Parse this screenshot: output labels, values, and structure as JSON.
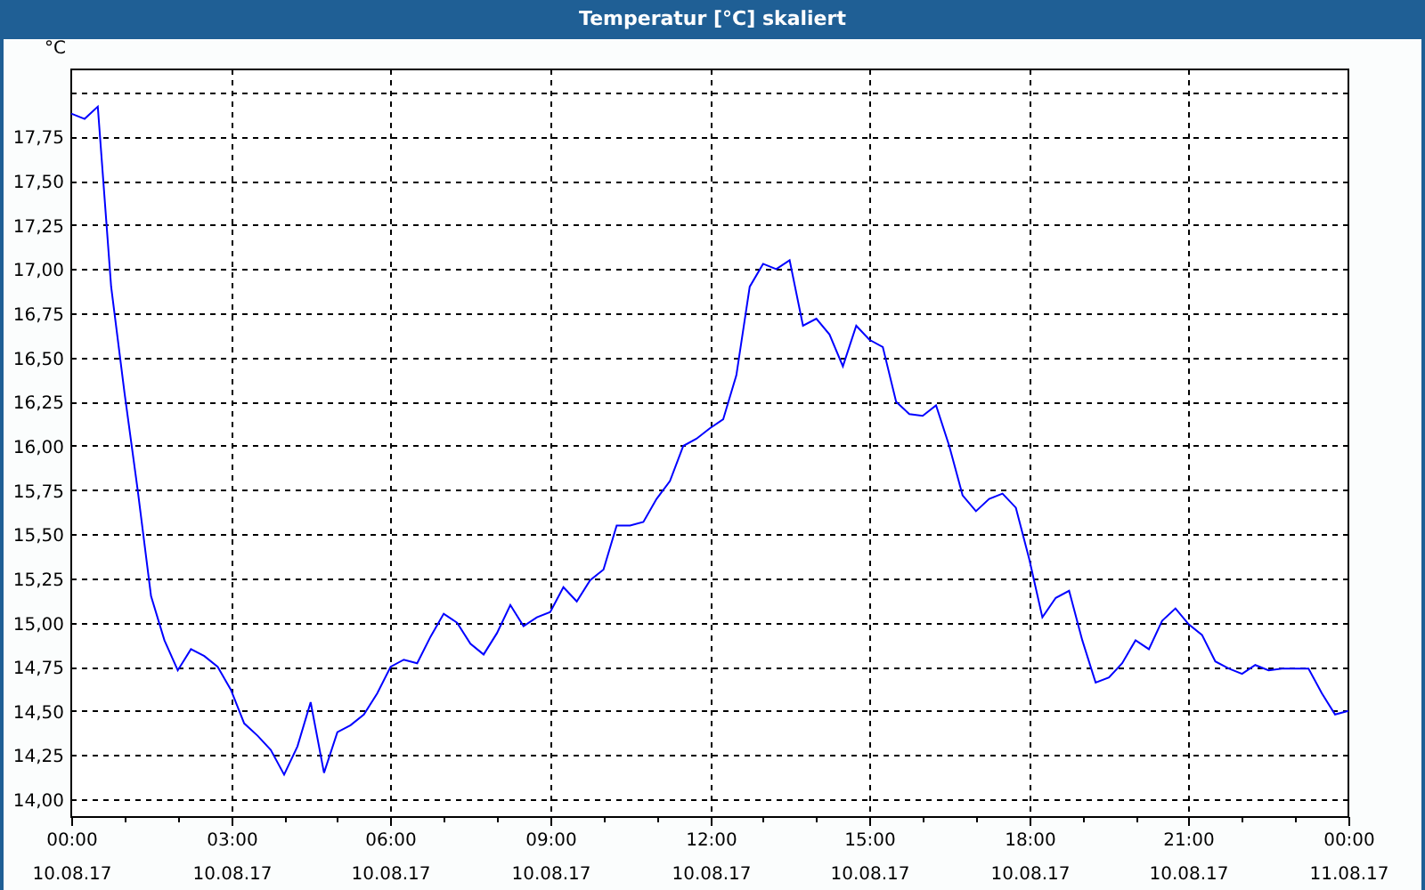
{
  "window": {
    "title": "Temperatur [°C] skaliert"
  },
  "chart": {
    "chart_data": {
      "type": "line",
      "grid": true,
      "ylabel": "°C",
      "ylim": [
        13.9,
        18.13
      ],
      "categories": [
        "00:00\n10.08.17",
        null,
        null,
        null,
        null,
        null,
        null,
        null,
        null,
        null,
        null,
        null,
        "03:00\n10.08.17",
        null,
        null,
        null,
        null,
        null,
        null,
        null,
        null,
        null,
        null,
        null,
        "06:00\n10.08.17",
        null,
        null,
        null,
        null,
        null,
        null,
        null,
        null,
        null,
        null,
        null,
        "09:00\n10.08.17",
        null,
        null,
        null,
        null,
        null,
        null,
        null,
        null,
        null,
        null,
        null,
        "12:00\n10.08.17",
        null,
        null,
        null,
        null,
        null,
        null,
        null,
        null,
        null,
        null,
        null,
        "15:00\n10.08.17",
        null,
        null,
        null,
        null,
        null,
        null,
        null,
        null,
        null,
        null,
        null,
        "18:00\n10.08.17",
        null,
        null,
        null,
        null,
        null,
        null,
        null,
        null,
        null,
        null,
        null,
        "21:00\n10.08.17",
        null,
        null,
        null,
        null,
        null,
        null,
        null,
        null,
        null,
        null,
        null,
        "00:00\n11.08.17"
      ],
      "yticks": [
        {
          "value": 14,
          "label": "14,00"
        },
        {
          "value": 14.25,
          "label": "14,25"
        },
        {
          "value": 14.5,
          "label": "14,50"
        },
        {
          "value": 14.75,
          "label": "14,75"
        },
        {
          "value": 15,
          "label": "15,00"
        },
        {
          "value": 15.25,
          "label": "15,25"
        },
        {
          "value": 15.5,
          "label": "15,50"
        },
        {
          "value": 15.75,
          "label": "15,75"
        },
        {
          "value": 16,
          "label": "16,00"
        },
        {
          "value": 16.25,
          "label": "16,25"
        },
        {
          "value": 16.5,
          "label": "16,50"
        },
        {
          "value": 16.75,
          "label": "16,75"
        },
        {
          "value": 17,
          "label": "17,00"
        },
        {
          "value": 17.25,
          "label": "17,25"
        },
        {
          "value": 17.5,
          "label": "17,50"
        },
        {
          "value": 17.75,
          "label": "17,75"
        }
      ],
      "series": [
        {
          "color": "#0000ff",
          "values": [
            17.88,
            17.85,
            17.92,
            16.9,
            16.3,
            15.75,
            15.15,
            14.9,
            14.73,
            14.85,
            14.81,
            14.75,
            14.62,
            14.43,
            14.36,
            14.28,
            14.14,
            14.3,
            14.55,
            14.15,
            14.38,
            14.42,
            14.48,
            14.6,
            14.75,
            14.79,
            14.77,
            14.92,
            15.05,
            15.0,
            14.88,
            14.82,
            14.94,
            15.1,
            14.98,
            15.03,
            15.06,
            15.2,
            15.12,
            15.24,
            15.3,
            15.55,
            15.55,
            15.57,
            15.7,
            15.8,
            16.0,
            16.04,
            16.1,
            16.15,
            16.4,
            16.9,
            17.03,
            17.0,
            17.05,
            16.68,
            16.72,
            16.63,
            16.45,
            16.68,
            16.6,
            16.56,
            16.25,
            16.18,
            16.17,
            16.23,
            16.0,
            15.72,
            15.63,
            15.7,
            15.73,
            15.65,
            15.36,
            15.03,
            15.14,
            15.18,
            14.9,
            14.66,
            14.69,
            14.77,
            14.9,
            14.85,
            15.01,
            15.08,
            14.99,
            14.93,
            14.78,
            14.74,
            14.71,
            14.76,
            14.73,
            14.74,
            14.74,
            14.74,
            14.6,
            14.48,
            14.5
          ]
        }
      ]
    }
  }
}
